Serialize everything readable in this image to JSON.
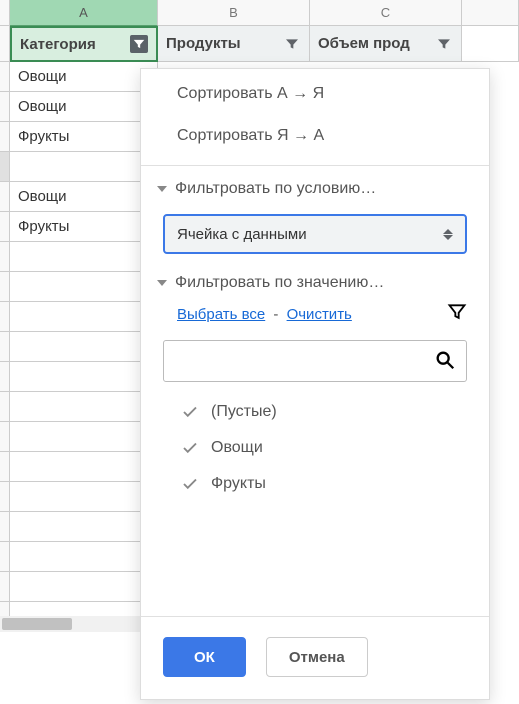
{
  "columns": {
    "A": "A",
    "B": "B",
    "C": "C"
  },
  "headers": {
    "A": "Категория",
    "B": "Продукты",
    "C": "Объем прод"
  },
  "rows": [
    "Овощи",
    "Овощи",
    "Фрукты",
    "",
    "Овощи",
    "Фрукты",
    "",
    "",
    "",
    "",
    "",
    "",
    "",
    "",
    "",
    "",
    "",
    "",
    ""
  ],
  "grouped_index": 3,
  "panel": {
    "sort_az": "Сортировать А → Я",
    "sort_za": "Сортировать Я → А",
    "filter_condition_header": "Фильтровать по условию…",
    "condition_value": "Ячейка с данными",
    "filter_value_header": "Фильтровать по значению…",
    "select_all": "Выбрать все",
    "clear": "Очистить",
    "search_placeholder": "",
    "values": [
      "(Пустые)",
      "Овощи",
      "Фрукты"
    ],
    "ok": "ОК",
    "cancel": "Отмена"
  }
}
